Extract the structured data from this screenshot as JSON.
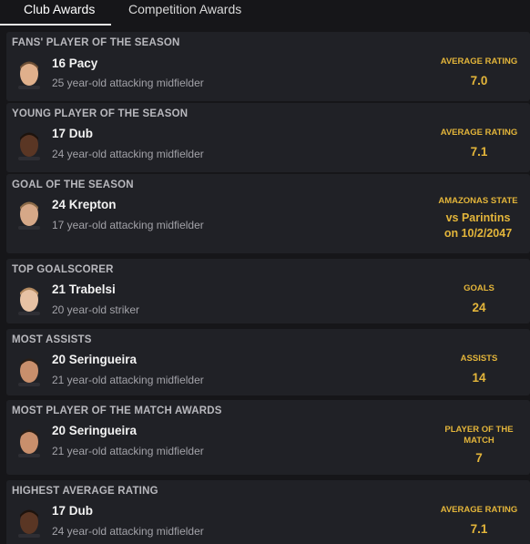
{
  "tabs": [
    {
      "label": "Club Awards",
      "active": true
    },
    {
      "label": "Competition Awards",
      "active": false
    }
  ],
  "awards": [
    {
      "title": "Fans' Player of the Season",
      "player": "16 Pacy",
      "description": "25 year-old attacking midfielder",
      "stat_label": "Average Rating",
      "stat_value": "7.0",
      "skin": "#e0b08c",
      "hair": "#6b4e35"
    },
    {
      "title": "Young Player of the Season",
      "player": "17 Dub",
      "description": "24 year-old attacking midfielder",
      "stat_label": "Average Rating",
      "stat_value": "7.1",
      "skin": "#5a3624",
      "hair": "#1d130d"
    },
    {
      "title": "Goal of the Season",
      "player": "24 Krepton",
      "description": "17 year-old attacking midfielder",
      "match_comp": "Amazonas State",
      "match_opp": "vs Parintins",
      "match_date": "on 10/2/2047",
      "skin": "#d6a888",
      "hair": "#8a6a48"
    },
    {
      "title": "Top Goalscorer",
      "player": "21 Trabelsi",
      "description": "20 year-old striker",
      "stat_label": "Goals",
      "stat_value": "24",
      "skin": "#e7c2a4",
      "hair": "#b38a60"
    },
    {
      "title": "Most Assists",
      "player": "20 Seringueira",
      "description": "21 year-old attacking midfielder",
      "stat_label": "Assists",
      "stat_value": "14",
      "skin": "#c98f6c",
      "hair": "#2a1e16"
    },
    {
      "title": "Most Player of the Match Awards",
      "player": "20 Seringueira",
      "description": "21 year-old attacking midfielder",
      "stat_label": "Player of the Match",
      "stat_value": "7",
      "skin": "#c98f6c",
      "hair": "#2a1e16"
    },
    {
      "title": "Highest Average Rating",
      "player": "17 Dub",
      "description": "24 year-old attacking midfielder",
      "stat_label": "Average Rating",
      "stat_value": "7.1",
      "skin": "#5a3624",
      "hair": "#1d130d"
    }
  ]
}
